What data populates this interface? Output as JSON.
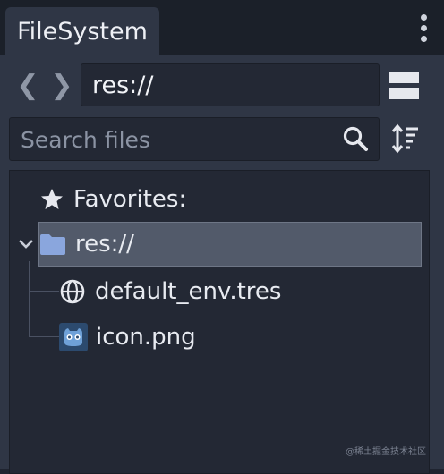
{
  "tab": {
    "title": "FileSystem"
  },
  "toolbar": {
    "back_glyph": "❮",
    "forward_glyph": "❯",
    "path": "res://",
    "search_placeholder": "Search files"
  },
  "tree": {
    "favorites_label": "Favorites:",
    "root_label": "res://",
    "files": [
      {
        "name": "default_env.tres",
        "icon": "globe-icon"
      },
      {
        "name": "icon.png",
        "icon": "godot-image-icon"
      }
    ]
  },
  "watermark": "@稀土掘金技术社区",
  "colors": {
    "panel": "#2f3645",
    "field": "#232834",
    "selection": "#525a6a",
    "folder": "#8aa6dd"
  }
}
